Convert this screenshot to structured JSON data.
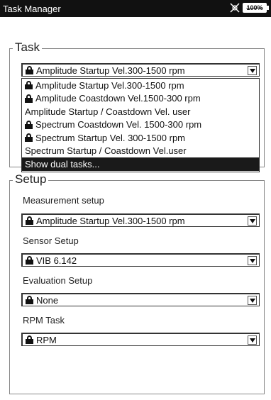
{
  "window": {
    "title": "Task Manager",
    "battery_text": "100%"
  },
  "task": {
    "legend": "Task",
    "selected": "Amplitude Startup Vel.300-1500 rpm",
    "options": [
      {
        "label": "Amplitude Startup Vel.300-1500 rpm",
        "locked": true
      },
      {
        "label": "Amplitude Coastdown Vel.1500-300 rpm",
        "locked": true
      },
      {
        "label": "Amplitude Startup / Coastdown Vel. user",
        "locked": false
      },
      {
        "label": "Spectrum Coastdown Vel. 1500-300 rpm",
        "locked": true
      },
      {
        "label": "Spectrum Startup Vel. 300-1500 rpm",
        "locked": true
      },
      {
        "label": "Spectrum Startup / Coastdown Vel.user",
        "locked": false
      },
      {
        "label": "Show dual tasks...",
        "locked": false,
        "highlighted": true
      }
    ]
  },
  "setup": {
    "legend": "Setup",
    "measurement_label": "Measurement setup",
    "measurement_value": "Amplitude Startup Vel.300-1500 rpm",
    "sensor_label": "Sensor Setup",
    "sensor_value": "VIB 6.142",
    "evaluation_label": "Evaluation Setup",
    "evaluation_value": "None",
    "rpm_label": "RPM Task",
    "rpm_value": "RPM"
  },
  "icons": {
    "status": "antenna-off-icon",
    "battery": "battery-icon",
    "lock": "lock-icon",
    "dropdown": "dropdown-arrow-icon"
  }
}
